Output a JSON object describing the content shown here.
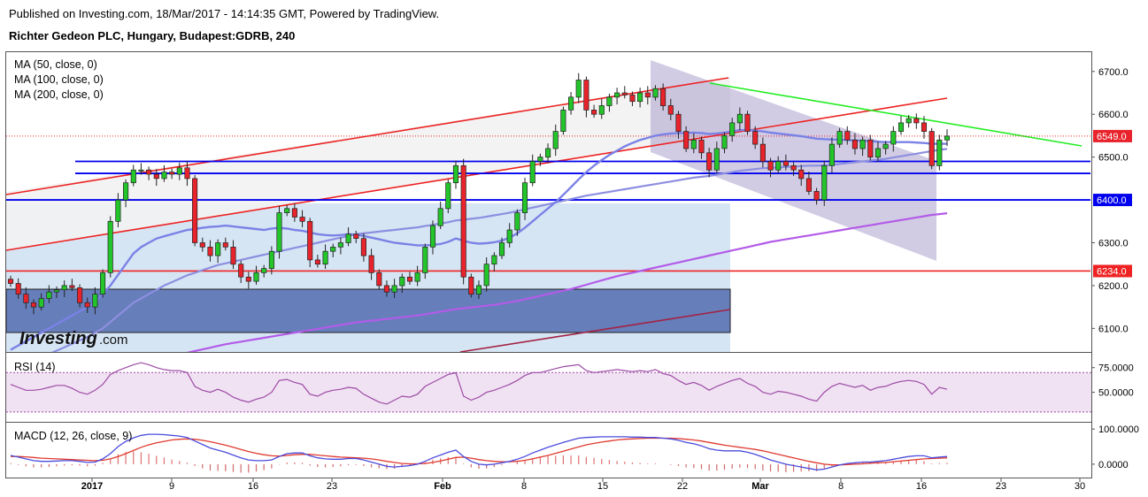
{
  "header": {
    "published": "Published on Investing.com, 18/Mar/2017 - 14:14:35 GMT, Powered by TradingView.",
    "symbol": "Richter Gedeon PLC, Hungary, Budapest:GDRB, 240"
  },
  "watermark": {
    "brand": "Investing",
    "suffix": ".com"
  },
  "colors": {
    "up_candle": "#23c52a",
    "down_candle": "#e8232b",
    "ma50": "#7b82e6",
    "ma100": "#8d8fe0",
    "ma200": "#b35be8",
    "support_line": "#0000ee",
    "channel_red": "#ee2222",
    "trend_green": "#22ee22",
    "rsi": "#9d4aa6",
    "macd": "#4b4bdd",
    "signal": "#e03a2f"
  },
  "chart_data": [
    {
      "type": "candlestick",
      "panel": "price",
      "legend": [
        "MA (50, close, 0)",
        "MA (100, close, 0)",
        "MA (200, close, 0)"
      ],
      "y_ticks": [
        "6700.0",
        "6600.0",
        "6500.0",
        "6300.0",
        "6200.0",
        "6100.0"
      ],
      "ylim": [
        6045,
        6745
      ],
      "x_ticks": [
        "2017",
        "9",
        "16",
        "23",
        "Feb",
        "8",
        "15",
        "22",
        "Mar",
        "8",
        "16",
        "23",
        "30"
      ],
      "last_price_label": "6549.0",
      "level_labels": [
        "6400.0",
        "6234.0"
      ],
      "levels": {
        "last_price": 6549,
        "support_blue": [
          6490,
          6462,
          6400
        ],
        "support_red": 6234
      },
      "close": [
        6205,
        6180,
        6160,
        6150,
        6170,
        6185,
        6190,
        6200,
        6195,
        6160,
        6150,
        6180,
        6230,
        6350,
        6400,
        6440,
        6470,
        6470,
        6460,
        6450,
        6465,
        6460,
        6475,
        6450,
        6300,
        6290,
        6270,
        6300,
        6290,
        6250,
        6220,
        6210,
        6230,
        6240,
        6280,
        6370,
        6380,
        6360,
        6350,
        6260,
        6250,
        6280,
        6290,
        6300,
        6320,
        6310,
        6270,
        6230,
        6200,
        6185,
        6200,
        6220,
        6210,
        6230,
        6290,
        6340,
        6380,
        6440,
        6480,
        6220,
        6180,
        6200,
        6250,
        6270,
        6300,
        6330,
        6370,
        6440,
        6490,
        6500,
        6520,
        6560,
        6610,
        6640,
        6680,
        6610,
        6600,
        6620,
        6640,
        6650,
        6645,
        6630,
        6650,
        6640,
        6660,
        6620,
        6600,
        6560,
        6520,
        6540,
        6510,
        6470,
        6520,
        6550,
        6580,
        6600,
        6560,
        6530,
        6490,
        6470,
        6490,
        6480,
        6470,
        6450,
        6420,
        6400,
        6480,
        6530,
        6560,
        6540,
        6520,
        6540,
        6500,
        6520,
        6530,
        6560,
        6580,
        6590,
        6580,
        6560,
        6480,
        6540,
        6549
      ],
      "ma50": [
        6050,
        6060,
        6070,
        6080,
        6090,
        6100,
        6110,
        6120,
        6130,
        6140,
        6150,
        6160,
        6180,
        6200,
        6225,
        6250,
        6275,
        6290,
        6300,
        6310,
        6315,
        6320,
        6325,
        6330,
        6332,
        6335,
        6337,
        6338,
        6340,
        6338,
        6336,
        6334,
        6332,
        6330,
        6333,
        6335,
        6333,
        6330,
        6328,
        6324,
        6320,
        6318,
        6317,
        6318,
        6320,
        6319,
        6316,
        6312,
        6308,
        6304,
        6300,
        6298,
        6296,
        6294,
        6294,
        6295,
        6297,
        6302,
        6310,
        6305,
        6300,
        6298,
        6299,
        6301,
        6305,
        6312,
        6322,
        6335,
        6350,
        6365,
        6380,
        6395,
        6412,
        6430,
        6448,
        6465,
        6480,
        6493,
        6505,
        6515,
        6525,
        6533,
        6540,
        6545,
        6550,
        6553,
        6555,
        6556,
        6556,
        6557,
        6556,
        6554,
        6555,
        6557,
        6560,
        6563,
        6563,
        6562,
        6560,
        6557,
        6555,
        6553,
        6551,
        6549,
        6546,
        6543,
        6542,
        6541,
        6541,
        6540,
        6539,
        6538,
        6537,
        6536,
        6535,
        6535,
        6535,
        6535,
        6534,
        6533,
        6531,
        6531,
        6531
      ],
      "ma100": [
        6000,
        6008,
        6016,
        6024,
        6032,
        6040,
        6048,
        6056,
        6064,
        6072,
        6080,
        6090,
        6100,
        6115,
        6130,
        6145,
        6160,
        6170,
        6180,
        6190,
        6200,
        6208,
        6216,
        6224,
        6230,
        6236,
        6242,
        6248,
        6252,
        6256,
        6260,
        6264,
        6268,
        6272,
        6276,
        6280,
        6284,
        6288,
        6292,
        6296,
        6300,
        6304,
        6308,
        6312,
        6316,
        6320,
        6322,
        6324,
        6326,
        6328,
        6330,
        6332,
        6334,
        6336,
        6339,
        6342,
        6345,
        6348,
        6352,
        6354,
        6356,
        6358,
        6361,
        6364,
        6367,
        6370,
        6374,
        6378,
        6382,
        6386,
        6390,
        6394,
        6398,
        6402,
        6406,
        6410,
        6413,
        6416,
        6419,
        6422,
        6425,
        6428,
        6431,
        6434,
        6437,
        6440,
        6443,
        6446,
        6449,
        6452,
        6454,
        6456,
        6459,
        6462,
        6465,
        6468,
        6470,
        6472,
        6474,
        6475,
        6476,
        6477,
        6478,
        6479,
        6480,
        6480,
        6481,
        6482,
        6484,
        6486,
        6488,
        6490,
        6492,
        6494,
        6496,
        6499,
        6502,
        6505,
        6508,
        6511,
        6514,
        6517,
        6519
      ],
      "ma200": [
        5930,
        5934,
        5938,
        5942,
        5946,
        5950,
        5954,
        5958,
        5962,
        5966,
        5970,
        5975,
        5980,
        5986,
        5992,
        5998,
        6004,
        6010,
        6016,
        6022,
        6028,
        6033,
        6038,
        6043,
        6047,
        6051,
        6055,
        6059,
        6063,
        6066,
        6069,
        6072,
        6075,
        6078,
        6081,
        6084,
        6087,
        6090,
        6093,
        6096,
        6099,
        6102,
        6105,
        6108,
        6111,
        6114,
        6116,
        6118,
        6120,
        6122,
        6124,
        6126,
        6128,
        6130,
        6133,
        6136,
        6139,
        6142,
        6145,
        6147,
        6149,
        6151,
        6153,
        6155,
        6158,
        6161,
        6164,
        6168,
        6172,
        6176,
        6180,
        6184,
        6188,
        6192,
        6197,
        6202,
        6207,
        6212,
        6217,
        6222,
        6226,
        6230,
        6234,
        6238,
        6242,
        6246,
        6250,
        6254,
        6258,
        6262,
        6266,
        6270,
        6274,
        6278,
        6282,
        6286,
        6290,
        6294,
        6298,
        6302,
        6305,
        6308,
        6311,
        6314,
        6317,
        6320,
        6323,
        6326,
        6329,
        6332,
        6335,
        6338,
        6341,
        6344,
        6347,
        6350,
        6353,
        6356,
        6359,
        6362,
        6365,
        6367,
        6369
      ]
    },
    {
      "type": "line",
      "panel": "rsi",
      "title": "RSI (14)",
      "y_ticks": [
        "75.0000",
        "50.0000"
      ],
      "ylim": [
        20,
        90
      ],
      "bands": [
        70,
        30
      ],
      "values": [
        58,
        55,
        52,
        52,
        53,
        55,
        57,
        57,
        54,
        50,
        48,
        52,
        58,
        68,
        72,
        75,
        78,
        80,
        78,
        75,
        73,
        72,
        72,
        70,
        56,
        52,
        50,
        53,
        50,
        45,
        42,
        40,
        43,
        45,
        50,
        62,
        63,
        60,
        58,
        48,
        46,
        50,
        52,
        53,
        55,
        54,
        48,
        44,
        40,
        38,
        42,
        46,
        45,
        48,
        56,
        60,
        64,
        68,
        70,
        46,
        42,
        45,
        50,
        52,
        55,
        58,
        62,
        67,
        70,
        70,
        72,
        74,
        76,
        77,
        78,
        72,
        70,
        71,
        72,
        73,
        72,
        71,
        72,
        71,
        73,
        69,
        67,
        62,
        58,
        60,
        57,
        52,
        56,
        59,
        62,
        64,
        59,
        56,
        50,
        48,
        51,
        50,
        48,
        46,
        43,
        41,
        50,
        56,
        59,
        57,
        55,
        57,
        52,
        55,
        56,
        59,
        61,
        62,
        61,
        58,
        48,
        55,
        53
      ]
    },
    {
      "type": "line",
      "panel": "macd",
      "title": "MACD (12, 26, close, 9)",
      "y_ticks": [
        "100.0000",
        "0.0000"
      ],
      "ylim": [
        -38,
        118
      ],
      "macd": [
        25,
        20,
        15,
        10,
        8,
        8,
        9,
        10,
        10,
        8,
        5,
        6,
        15,
        30,
        50,
        65,
        75,
        82,
        85,
        85,
        84,
        82,
        80,
        76,
        66,
        56,
        46,
        40,
        34,
        26,
        18,
        12,
        10,
        10,
        12,
        22,
        30,
        32,
        32,
        24,
        18,
        15,
        14,
        14,
        16,
        16,
        12,
        6,
        0,
        -6,
        -8,
        -6,
        -4,
        0,
        8,
        18,
        26,
        34,
        40,
        22,
        8,
        0,
        -2,
        0,
        4,
        8,
        14,
        22,
        32,
        40,
        48,
        55,
        62,
        68,
        74,
        76,
        77,
        78,
        78,
        78,
        78,
        77,
        77,
        76,
        76,
        74,
        72,
        68,
        62,
        58,
        52,
        44,
        40,
        38,
        38,
        38,
        34,
        28,
        20,
        12,
        6,
        0,
        -4,
        -8,
        -12,
        -16,
        -14,
        -8,
        -2,
        2,
        4,
        6,
        6,
        8,
        10,
        14,
        18,
        22,
        24,
        24,
        18,
        20,
        22
      ],
      "signal": [
        22,
        22,
        21,
        19,
        17,
        16,
        15,
        14,
        13,
        12,
        11,
        10,
        11,
        15,
        22,
        30,
        39,
        48,
        55,
        61,
        65,
        69,
        71,
        72,
        71,
        68,
        64,
        59,
        54,
        48,
        42,
        36,
        31,
        27,
        24,
        23,
        25,
        27,
        28,
        28,
        26,
        24,
        22,
        20,
        19,
        18,
        17,
        15,
        12,
        8,
        5,
        2,
        1,
        1,
        2,
        5,
        9,
        14,
        19,
        20,
        17,
        13,
        10,
        8,
        7,
        7,
        8,
        11,
        15,
        20,
        25,
        31,
        37,
        43,
        49,
        55,
        59,
        63,
        66,
        69,
        71,
        72,
        73,
        74,
        74,
        74,
        74,
        73,
        71,
        69,
        66,
        62,
        58,
        54,
        51,
        48,
        45,
        42,
        38,
        33,
        28,
        23,
        18,
        13,
        8,
        4,
        0,
        -2,
        -2,
        -1,
        0,
        1,
        3,
        4,
        5,
        7,
        9,
        11,
        13,
        15,
        16,
        17,
        18
      ]
    }
  ]
}
